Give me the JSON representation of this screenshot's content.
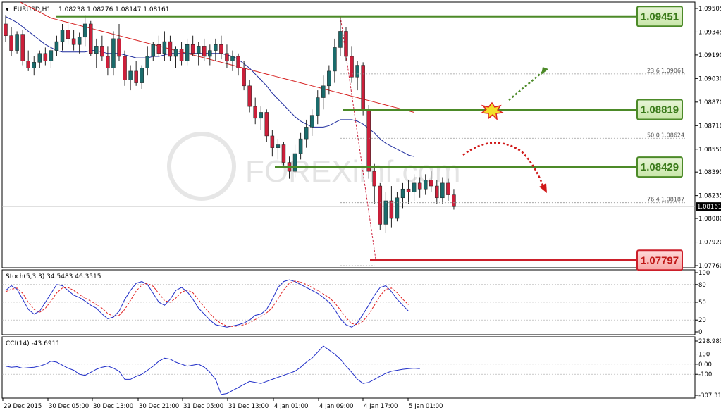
{
  "header": {
    "symbol": "EURUSD,H1",
    "ohlc": "1.08238 1.08276 1.08147 1.08161"
  },
  "watermark": "FOREXimf.com",
  "colors": {
    "bull": "#1a6b6b",
    "bear": "#cc1f3a",
    "ma_fast": "#1f2d9e",
    "ma_slow": "#d61f1f",
    "resistance": "#4c8a28",
    "support": "#cc1f2a",
    "stoch_main": "#1f2dc8",
    "stoch_signal": "#e01f1f",
    "cci": "#1f2dc8"
  },
  "chart_data": [
    {
      "type": "candlestick",
      "ylim": [
        1.0776,
        1.09505
      ],
      "y_ticks": [
        "1.09505",
        "1.09345",
        "1.09190",
        "1.09030",
        "1.08870",
        "1.08710",
        "1.08550",
        "1.08395",
        "1.08235",
        "1.08080",
        "1.07920",
        "1.07760"
      ],
      "current_price": "1.08161",
      "x_ticks": [
        "29 Dec 2015",
        "30 Dec 05:00",
        "30 Dec 13:00",
        "30 Dec 21:00",
        "31 Dec 05:00",
        "31 Dec 13:00",
        "4 Jan 01:00",
        "4 Jan 09:00",
        "4 Jan 17:00",
        "5 Jan 01:00"
      ],
      "candles_ohlc": [
        [
          1.094,
          1.0946,
          1.0928,
          1.0932
        ],
        [
          1.0932,
          1.0938,
          1.0918,
          1.0922
        ],
        [
          1.0922,
          1.0935,
          1.092,
          1.0933
        ],
        [
          1.0933,
          1.0936,
          1.0912,
          1.0915
        ],
        [
          1.0915,
          1.0922,
          1.0908,
          1.091
        ],
        [
          1.091,
          1.0918,
          1.0905,
          1.0914
        ],
        [
          1.0914,
          1.0922,
          1.091,
          1.092
        ],
        [
          1.092,
          1.0924,
          1.0912,
          1.0915
        ],
        [
          1.0915,
          1.0925,
          1.091,
          1.0922
        ],
        [
          1.0922,
          1.0932,
          1.0918,
          1.0928
        ],
        [
          1.0928,
          1.094,
          1.0922,
          1.0936
        ],
        [
          1.0936,
          1.0942,
          1.0926,
          1.093
        ],
        [
          1.093,
          1.0936,
          1.0922,
          1.0926
        ],
        [
          1.0926,
          1.0934,
          1.092,
          1.0931
        ],
        [
          1.0931,
          1.0946,
          1.0925,
          1.094
        ],
        [
          1.094,
          1.0942,
          1.0918,
          1.092
        ],
        [
          1.092,
          1.093,
          1.091,
          1.0925
        ],
        [
          1.0925,
          1.0932,
          1.0915,
          1.0918
        ],
        [
          1.0918,
          1.0925,
          1.0905,
          1.091
        ],
        [
          1.091,
          1.0935,
          1.0905,
          1.093
        ],
        [
          1.093,
          1.094,
          1.0915,
          1.0918
        ],
        [
          1.0918,
          1.0922,
          1.0898,
          1.0902
        ],
        [
          1.0902,
          1.0912,
          1.0895,
          1.0908
        ],
        [
          1.0908,
          1.0915,
          1.0898,
          1.09
        ],
        [
          1.09,
          1.0912,
          1.0896,
          1.091
        ],
        [
          1.091,
          1.0925,
          1.0905,
          1.0918
        ],
        [
          1.0918,
          1.0928,
          1.0915,
          1.0926
        ],
        [
          1.0926,
          1.0932,
          1.0918,
          1.092
        ],
        [
          1.092,
          1.0935,
          1.0915,
          1.0928
        ],
        [
          1.0928,
          1.0932,
          1.0915,
          1.0918
        ],
        [
          1.0918,
          1.0925,
          1.091,
          1.0923
        ],
        [
          1.0923,
          1.0928,
          1.0912,
          1.0915
        ],
        [
          1.0915,
          1.093,
          1.0912,
          1.0926
        ],
        [
          1.0926,
          1.0932,
          1.0918,
          1.092
        ],
        [
          1.092,
          1.0928,
          1.0912,
          1.0925
        ],
        [
          1.0925,
          1.093,
          1.0915,
          1.0918
        ],
        [
          1.0918,
          1.0926,
          1.0912,
          1.0922
        ],
        [
          1.0922,
          1.093,
          1.0915,
          1.0926
        ],
        [
          1.0926,
          1.0932,
          1.0916,
          1.092
        ],
        [
          1.092,
          1.0926,
          1.091,
          1.0915
        ],
        [
          1.0915,
          1.0922,
          1.0908,
          1.0918
        ],
        [
          1.0918,
          1.092,
          1.0905,
          1.091
        ],
        [
          1.091,
          1.0915,
          1.0895,
          1.0898
        ],
        [
          1.0898,
          1.0902,
          1.088,
          1.0884
        ],
        [
          1.0884,
          1.089,
          1.0872,
          1.0876
        ],
        [
          1.0876,
          1.0884,
          1.0868,
          1.088
        ],
        [
          1.088,
          1.0882,
          1.086,
          1.0864
        ],
        [
          1.0864,
          1.0868,
          1.085,
          1.0856
        ],
        [
          1.0856,
          1.0862,
          1.0848,
          1.0858
        ],
        [
          1.0858,
          1.086,
          1.0844,
          1.0846
        ],
        [
          1.0846,
          1.085,
          1.0835,
          1.084
        ],
        [
          1.084,
          1.0858,
          1.0836,
          1.0852
        ],
        [
          1.0852,
          1.0866,
          1.0848,
          1.0862
        ],
        [
          1.0862,
          1.0875,
          1.0856,
          1.087
        ],
        [
          1.087,
          1.0882,
          1.0864,
          1.0878
        ],
        [
          1.0878,
          1.0895,
          1.0872,
          1.089
        ],
        [
          1.089,
          1.0905,
          1.0882,
          1.0898
        ],
        [
          1.0898,
          1.0912,
          1.0892,
          1.0908
        ],
        [
          1.0908,
          1.093,
          1.09,
          1.0924
        ],
        [
          1.0924,
          1.0945,
          1.0918,
          1.0935
        ],
        [
          1.0935,
          1.0938,
          1.0915,
          1.0918
        ],
        [
          1.0918,
          1.0925,
          1.09,
          1.0904
        ],
        [
          1.0904,
          1.0915,
          1.0895,
          1.0912
        ],
        [
          1.0912,
          1.0914,
          1.0878,
          1.0882
        ],
        [
          1.0882,
          1.0885,
          1.0835,
          1.084
        ],
        [
          1.084,
          1.0845,
          1.0818,
          1.083
        ],
        [
          1.083,
          1.0832,
          1.08,
          1.0804
        ],
        [
          1.0804,
          1.0826,
          1.0798,
          1.082
        ],
        [
          1.082,
          1.083,
          1.0802,
          1.0808
        ],
        [
          1.0808,
          1.0826,
          1.0806,
          1.0822
        ],
        [
          1.0822,
          1.0832,
          1.0815,
          1.0828
        ],
        [
          1.0828,
          1.0834,
          1.0818,
          1.0826
        ],
        [
          1.0826,
          1.0838,
          1.082,
          1.0832
        ],
        [
          1.0832,
          1.0836,
          1.0822,
          1.0828
        ],
        [
          1.0828,
          1.0838,
          1.0824,
          1.0834
        ],
        [
          1.0834,
          1.084,
          1.0826,
          1.083
        ],
        [
          1.083,
          1.0834,
          1.0818,
          1.0822
        ],
        [
          1.0822,
          1.0836,
          1.0818,
          1.0832
        ],
        [
          1.0832,
          1.0835,
          1.082,
          1.0824
        ],
        [
          1.0824,
          1.0828,
          1.0814,
          1.0816
        ]
      ],
      "ma_fast": [
        1.0945,
        1.0943,
        1.0941,
        1.0938,
        1.0935,
        1.0932,
        1.0929,
        1.0926,
        1.0924,
        1.0922,
        1.0921,
        1.0921,
        1.0921,
        1.0921,
        1.0921,
        1.0922,
        1.0922,
        1.0921,
        1.092,
        1.092,
        1.092,
        1.0919,
        1.0918,
        1.0917,
        1.0917,
        1.0917,
        1.0918,
        1.0918,
        1.0919,
        1.092,
        1.092,
        1.092,
        1.092,
        1.092,
        1.092,
        1.092,
        1.092,
        1.092,
        1.092,
        1.0919,
        1.0918,
        1.0916,
        1.0913,
        1.091,
        1.0906,
        1.0902,
        1.0898,
        1.0893,
        1.0889,
        1.0885,
        1.0881,
        1.0877,
        1.0874,
        1.0872,
        1.087,
        1.087,
        1.087,
        1.0871,
        1.0873,
        1.0875,
        1.0875,
        1.0875,
        1.0874,
        1.0872,
        1.0869,
        1.0866,
        1.0862,
        1.0859,
        1.0857,
        1.0855,
        1.0853,
        1.0851,
        1.085
      ],
      "ma_slow": [
        1.096,
        1.0958,
        1.0956,
        1.0954,
        1.0952,
        1.095,
        1.0948,
        1.0946,
        1.0944,
        1.0943,
        1.0942,
        1.0941,
        1.094,
        1.0939,
        1.0938,
        1.0937,
        1.0936,
        1.0935,
        1.0934,
        1.0933,
        1.0932,
        1.0931,
        1.093,
        1.0929,
        1.0928,
        1.0927,
        1.0926,
        1.0925,
        1.0924,
        1.0923,
        1.0922,
        1.0921,
        1.092,
        1.0919,
        1.0918,
        1.0917,
        1.0916,
        1.0915,
        1.0914,
        1.0913,
        1.0912,
        1.0911,
        1.091,
        1.0909,
        1.0908,
        1.0907,
        1.0906,
        1.0905,
        1.0904,
        1.0903,
        1.0902,
        1.0901,
        1.09,
        1.0899,
        1.0898,
        1.0897,
        1.0896,
        1.0895,
        1.0894,
        1.0893,
        1.0892,
        1.0891,
        1.089,
        1.0889,
        1.0888,
        1.0887,
        1.0886,
        1.0885,
        1.0884,
        1.0883,
        1.0882,
        1.0881,
        1.088
      ],
      "levels": [
        {
          "label": "1.09451",
          "value": 1.09451,
          "kind": "resistance"
        },
        {
          "label": "1.08819",
          "value": 1.08819,
          "kind": "resistance"
        },
        {
          "label": "1.08429",
          "value": 1.08429,
          "kind": "resistance"
        },
        {
          "label": "1.07797",
          "value": 1.07797,
          "kind": "support"
        }
      ],
      "fibonacci": [
        {
          "ratio": "23.6",
          "price": "1.09061",
          "value": 1.09061
        },
        {
          "ratio": "50.0",
          "price": "1.08624",
          "value": 1.08624
        },
        {
          "ratio": "76.4",
          "price": "1.08187",
          "value": 1.08187
        }
      ]
    },
    {
      "type": "line",
      "label": "Stoch(5,3,3) 34.5483 46.3515",
      "ylim": [
        0,
        100
      ],
      "y_ticks": [
        "100",
        "80",
        "50",
        "20",
        "0"
      ],
      "levels": [
        80,
        50,
        20
      ],
      "series": [
        {
          "values": [
            70,
            78,
            72,
            55,
            38,
            30,
            35,
            50,
            65,
            80,
            78,
            70,
            62,
            58,
            52,
            45,
            40,
            30,
            22,
            25,
            35,
            55,
            70,
            82,
            85,
            80,
            65,
            50,
            45,
            55,
            70,
            75,
            68,
            55,
            40,
            30,
            20,
            12,
            10,
            8,
            10,
            12,
            15,
            20,
            28,
            30,
            38,
            55,
            75,
            85,
            88,
            85,
            80,
            75,
            70,
            65,
            58,
            50,
            38,
            22,
            12,
            8,
            15,
            30,
            45,
            62,
            75,
            78,
            68,
            55,
            45,
            35
          ]
        },
        {
          "values": [
            68,
            72,
            74,
            65,
            50,
            38,
            33,
            40,
            52,
            66,
            74,
            75,
            70,
            63,
            57,
            52,
            46,
            40,
            31,
            26,
            28,
            38,
            53,
            69,
            79,
            82,
            77,
            65,
            53,
            50,
            57,
            67,
            71,
            66,
            54,
            42,
            31,
            21,
            14,
            10,
            9,
            10,
            12,
            15,
            21,
            26,
            32,
            41,
            56,
            71,
            82,
            86,
            84,
            80,
            75,
            70,
            64,
            58,
            49,
            37,
            24,
            14,
            12,
            18,
            30,
            45,
            61,
            72,
            74,
            66,
            55,
            46
          ]
        }
      ]
    },
    {
      "type": "line",
      "label": "CCI(14) -43.6911",
      "ylim": [
        -307.316,
        228.983
      ],
      "y_ticks": [
        "228.983",
        "100",
        "0.00",
        "-100",
        "-307.316"
      ],
      "levels": [
        100,
        0,
        -100
      ],
      "series": [
        {
          "values": [
            -20,
            -30,
            -25,
            -40,
            -35,
            -30,
            -20,
            0,
            30,
            20,
            -10,
            -40,
            -60,
            -100,
            -110,
            -80,
            -50,
            -30,
            -20,
            -40,
            -70,
            -150,
            -150,
            -120,
            -100,
            -60,
            -20,
            30,
            60,
            50,
            20,
            0,
            -20,
            -10,
            0,
            -30,
            -80,
            -150,
            -300,
            -290,
            -260,
            -230,
            -200,
            -170,
            -180,
            -190,
            -170,
            -150,
            -130,
            -110,
            -90,
            -70,
            -30,
            20,
            60,
            120,
            180,
            140,
            100,
            50,
            -20,
            -80,
            -150,
            -190,
            -180,
            -150,
            -120,
            -90,
            -70,
            -60,
            -50,
            -45,
            -40,
            -44
          ]
        }
      ]
    }
  ]
}
